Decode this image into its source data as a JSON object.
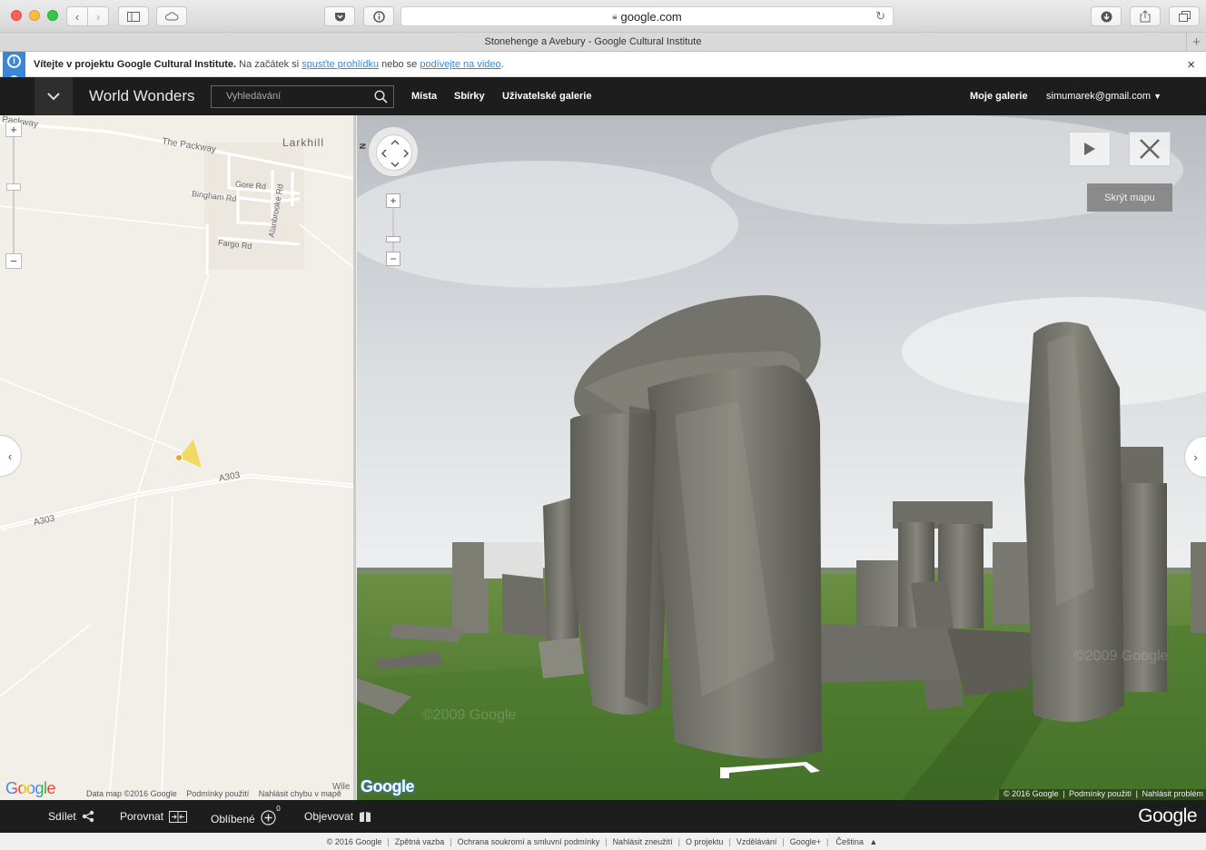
{
  "browser": {
    "url": "google.com",
    "tab_title": "Stonehenge a Avebury - Google Cultural Institute"
  },
  "banner": {
    "bold_text": "Vítejte v projektu Google Cultural Institute.",
    "text1": " Na začátek si ",
    "link1": "spusťte prohlídku",
    "text2": " nebo se ",
    "link2": "podívejte na video",
    "text3": ".",
    "close": "×"
  },
  "header": {
    "brand": "World Wonders",
    "search_placeholder": "Vyhledávání",
    "nav": [
      "Místa",
      "Sbírky",
      "Uživatelské galerie"
    ],
    "my_galleries": "Moje galerie",
    "user_email": "simumarek@gmail.com"
  },
  "map": {
    "labels": {
      "packway_top": "Packway",
      "packway": "The Packway",
      "larkhill": "Larkhill",
      "gore_rd": "Gore Rd",
      "bingham_rd": "Bingham Rd",
      "alanbrooke_rd": "Alanbrooke Rd",
      "fargo_rd": "Fargo Rd",
      "a303_right": "A303",
      "a303_left": "A303",
      "wile": "Wile"
    },
    "logo": "Google",
    "footer": {
      "data": "Data map ©2016 Google",
      "terms": "Podmínky použití",
      "report": "Nahlásit chybu v mapě"
    }
  },
  "streetview": {
    "north": "N",
    "hide_map": "Skrýt mapu",
    "watermark1": "©2009 Google",
    "watermark2": "©2009 Google",
    "logo": "Google",
    "footer": {
      "copyright": "© 2016 Google",
      "terms": "Podmínky použití",
      "report": "Nahlásit problém"
    }
  },
  "bottombar": {
    "share": "Sdílet",
    "compare": "Porovnat",
    "favorites": "Oblíbené",
    "favorites_count": "0",
    "discover": "Objevovat",
    "logo": "Google"
  },
  "footer": {
    "items": [
      "© 2016 Google",
      "Zpětná vazba",
      "Ochrana soukromí a smluvní podmínky",
      "Nahlásit zneužití",
      "O projektu",
      "Vzdělávání",
      "Google+",
      "Čeština"
    ]
  },
  "colors": {
    "header_bg": "#1d1d1d",
    "link_blue": "#3b86d6",
    "map_bg": "#f2efe9",
    "grass": "#4e7a32"
  }
}
